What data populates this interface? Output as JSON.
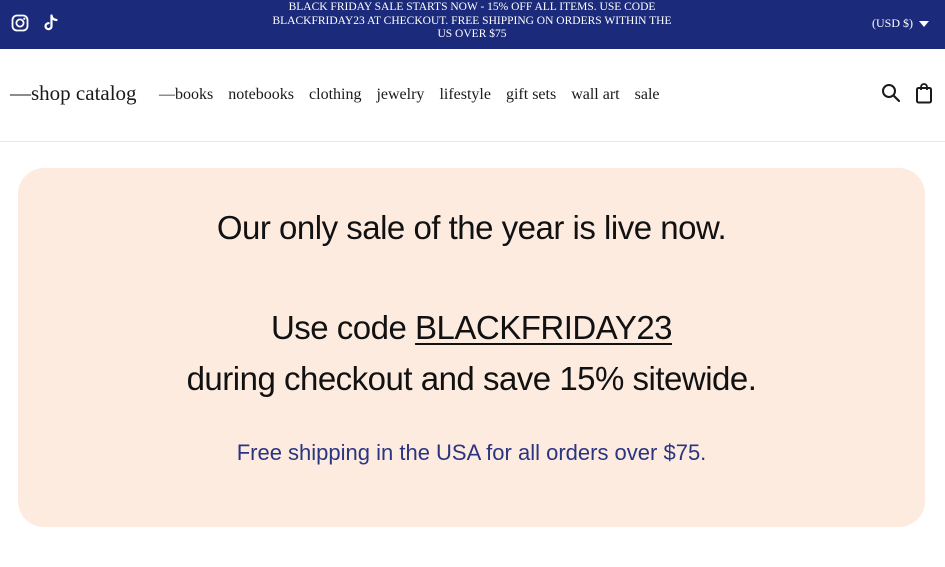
{
  "announcement": {
    "message": "BLACK FRIDAY SALE STARTS NOW - 15% OFF ALL ITEMS. USE CODE BLACKFRIDAY23 AT CHECKOUT. FREE SHIPPING ON ORDERS WITHIN THE US OVER $75",
    "currency": "(USD $)",
    "social_icons": [
      "instagram-icon",
      "tiktok-icon"
    ],
    "background_color": "#1b2a7a"
  },
  "header": {
    "logo": "—shop catalog",
    "nav": [
      {
        "label": "—books"
      },
      {
        "label": "notebooks"
      },
      {
        "label": "clothing"
      },
      {
        "label": "jewelry"
      },
      {
        "label": "lifestyle"
      },
      {
        "label": "gift sets"
      },
      {
        "label": "wall art"
      },
      {
        "label": "sale"
      }
    ],
    "icons": [
      "search-icon",
      "shopping-bag-icon"
    ]
  },
  "hero": {
    "headline": "Our only sale of the year is live now.",
    "code_prefix": "Use code ",
    "code": "BLACKFRIDAY23",
    "line3": "during checkout and save 15% sitewide.",
    "shipping_note": "Free shipping in the USA for all orders over $75.",
    "background_color": "#fdebe0",
    "note_color": "#2a3580"
  }
}
